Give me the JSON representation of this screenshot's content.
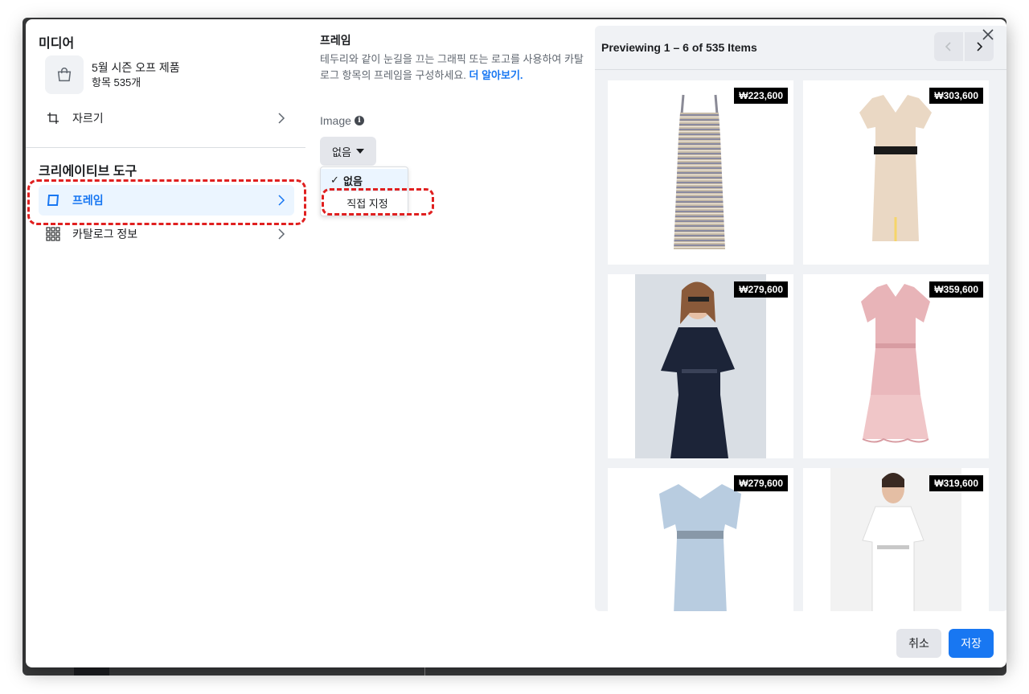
{
  "left": {
    "media_title": "미디어",
    "media_name": "5월 시즌 오프 제품",
    "media_count": "항목 535개",
    "crop_label": "자르기",
    "creative_title": "크리에이티브 도구",
    "frame_label": "프레임",
    "catalog_label": "카탈로그 정보"
  },
  "middle": {
    "title": "프레임",
    "description": "테두리와 같이 눈길을 끄는 그래픽 또는 로고를 사용하여 카탈로그 항목의 프레임을 구성하세요.",
    "learn_more": "더 알아보기.",
    "image_label": "Image",
    "select_value": "없음",
    "options": [
      "없음",
      "직접 지정"
    ]
  },
  "preview": {
    "title": "Previewing 1 – 6 of 535 Items",
    "items": [
      {
        "price": "₩223,600"
      },
      {
        "price": "₩303,600"
      },
      {
        "price": "₩279,600"
      },
      {
        "price": "₩359,600"
      },
      {
        "price": "₩279,600"
      },
      {
        "price": "₩319,600"
      }
    ]
  },
  "footer": {
    "cancel": "취소",
    "save": "저장"
  },
  "colors": {
    "accent": "#1877f2",
    "highlight_dash": "#e02020"
  }
}
